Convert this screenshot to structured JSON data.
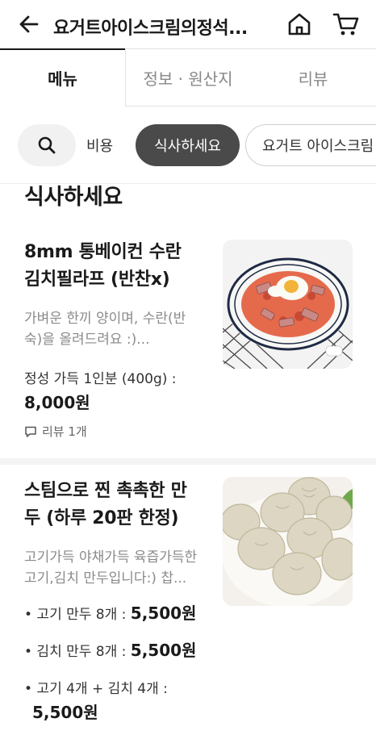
{
  "header": {
    "title": "요거트아이스크림의정석...",
    "icons": [
      "back-arrow-icon",
      "home-icon",
      "cart-icon"
    ]
  },
  "tabs": [
    {
      "label": "메뉴",
      "active": true
    },
    {
      "label": "정보 · 원산지",
      "active": false
    },
    {
      "label": "리뷰",
      "active": false
    }
  ],
  "chips": {
    "search_icon": "search-icon",
    "items": [
      {
        "label": "비용",
        "active": false
      },
      {
        "label": "식사하세요",
        "active": true
      },
      {
        "label": "요거트 아이스크림",
        "active": false
      }
    ]
  },
  "section": {
    "title": "식사하세요"
  },
  "items": [
    {
      "name_line1": "8mm 통베이컨 수란",
      "name_line2": "김치필라프 (반찬x)",
      "desc_line1": "가벼운 한끼 양이며, 수란(반",
      "desc_line2": "숙)을 올려드려요 :)...",
      "option_label": "정성 가득 1인분 (400g) :",
      "option_price": "8,000원",
      "review": "리뷰 1개"
    },
    {
      "name_line1": "스팀으로 찐 촉촉한 만",
      "name_line2": "두 (하루 20판 한정)",
      "desc_line1": "고기가득 야채가득 육즙가득한",
      "desc_line2": "고기,김치 만두입니다:)  찹...",
      "options": [
        {
          "label": "• 고기 만두 8개 : ",
          "price": "5,500원"
        },
        {
          "label": "• 김치 만두 8개 : ",
          "price": "5,500원"
        },
        {
          "label": "• 고기 4개 + 김치 4개 :",
          "price": "5,500원"
        }
      ]
    }
  ],
  "colors": {
    "active_chip": "#4a4a4a",
    "muted_text": "#8a8a8a"
  }
}
